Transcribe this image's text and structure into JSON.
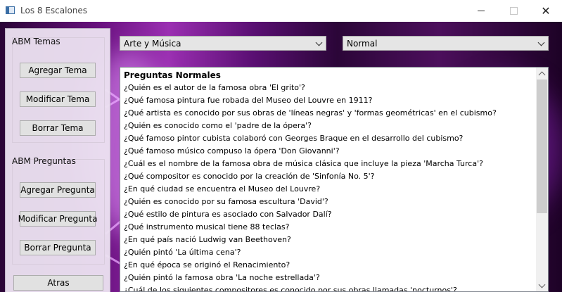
{
  "window": {
    "title": "Los 8 Escalones",
    "icon": "app-window-icon",
    "controls": {
      "minimize": "minimize-icon",
      "maximize": "maximize-icon",
      "close": "✕"
    }
  },
  "sidebar": {
    "group_temas_label": "ABM Temas",
    "agregar_tema": "Agregar Tema",
    "modificar_tema": "Modificar Tema",
    "borrar_tema": "Borrar Tema",
    "group_preguntas_label": "ABM Preguntas",
    "agregar_pregunta": "Agregar Pregunta",
    "modificar_pregunta": "Modificar Pregunta",
    "borrar_pregunta": "Borrar Pregunta",
    "atras": "Atras"
  },
  "filters": {
    "tema_selected": "Arte y Música",
    "dificultad_selected": "Normal"
  },
  "questions": {
    "header": "Preguntas Normales",
    "items": [
      "¿Quién es el autor de la famosa obra 'El grito'?",
      "¿Qué famosa pintura fue robada del Museo del Louvre en 1911?",
      "¿Qué artista es conocido por sus obras de 'líneas negras' y 'formas geométricas' en el cubismo?",
      "¿Quién es conocido como el 'padre de la ópera'?",
      "¿Qué famoso pintor cubista colaboró con Georges Braque en el desarrollo del cubismo?",
      "¿Qué famoso músico compuso la ópera 'Don Giovanni'?",
      "¿Cuál es el nombre de la famosa obra de música clásica que incluye la pieza 'Marcha Turca'?",
      "¿Qué compositor es conocido por la creación de 'Sinfonía No. 5'?",
      "¿En qué ciudad se encuentra el Museo del Louvre?",
      "¿Quién es conocido por su famosa escultura 'David'?",
      "¿Qué estilo de pintura es asociado con Salvador Dalí?",
      "¿Qué instrumento musical tiene 88 teclas?",
      "¿En qué país nació Ludwig van Beethoven?",
      "¿Quién pintó 'La última cena'?",
      "¿En qué época se originó el Renacimiento?",
      "¿Quién pintó la famosa obra 'La noche estrellada'?",
      "¿Cuál de los siguientes compositores es conocido por sus obras llamadas 'nocturnos'?"
    ]
  },
  "colors": {
    "background_purple": "#6a1280",
    "panel": "#ebe1f0",
    "button": "#e1e1e1",
    "combo": "#e5e5e5"
  }
}
